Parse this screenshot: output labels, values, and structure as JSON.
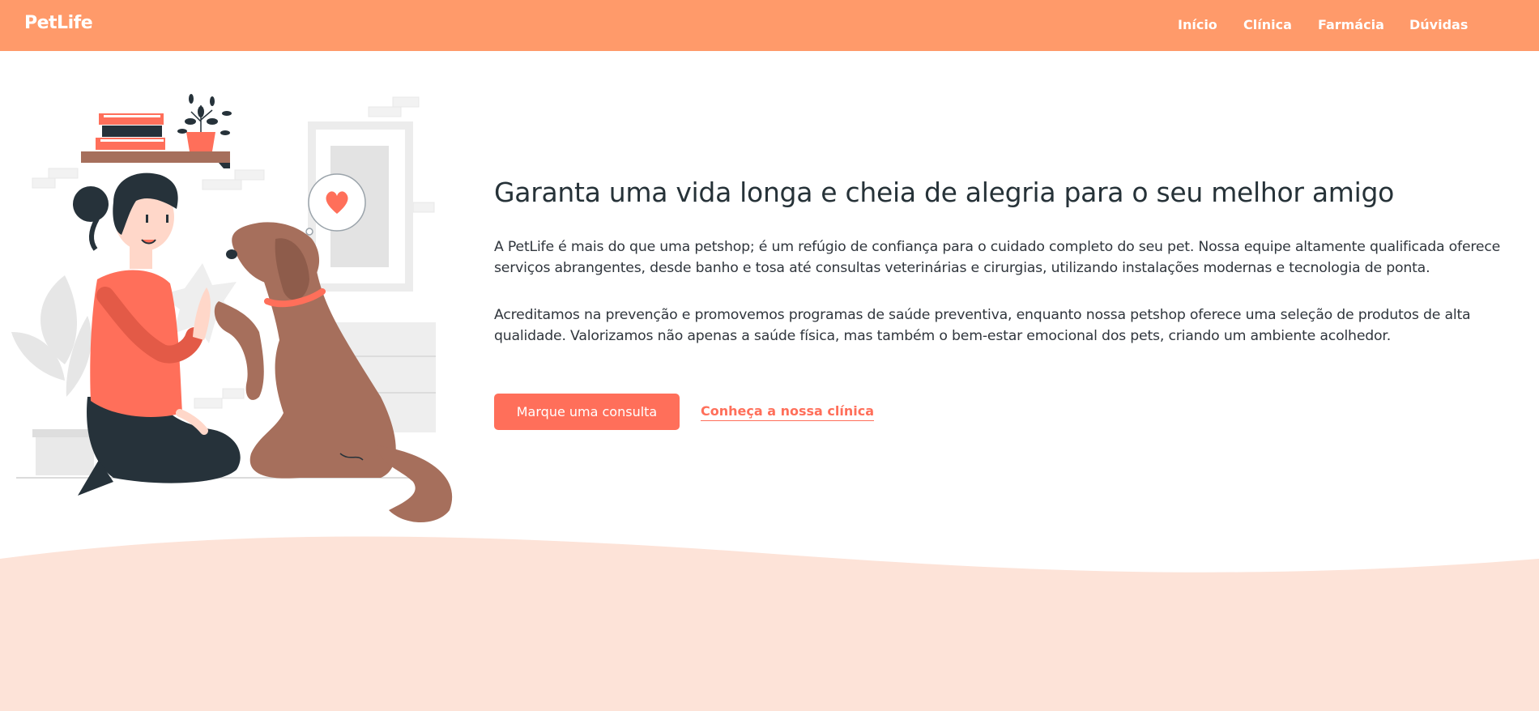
{
  "header": {
    "logo": "PetLife",
    "nav": [
      {
        "label": "Início"
      },
      {
        "label": "Clínica"
      },
      {
        "label": "Farmácia"
      },
      {
        "label": "Dúvidas"
      }
    ]
  },
  "hero": {
    "title": "Garanta uma vida longa e cheia de alegria para o seu melhor amigo",
    "paragraph1": "A PetLife é mais do que uma petshop; é um refúgio de confiança para o cuidado completo do seu pet. Nossa equipe altamente qualificada oferece serviços abrangentes, desde banho e tosa até consultas veterinárias e cirurgias, utilizando instalações modernas e tecnologia de ponta.",
    "paragraph2": "Acreditamos na prevenção e promovemos programas de saúde preventiva, enquanto nossa petshop oferece uma seleção de produtos de alta qualidade. Valorizamos não apenas a saúde física, mas também o bem-estar emocional dos pets, criando um ambiente acolhedor.",
    "cta_primary": "Marque uma consulta",
    "cta_secondary": "Conheça a nossa clínica"
  },
  "colors": {
    "header_bg": "#ff9a6a",
    "accent": "#ff6f5a",
    "wave": "#fde3d8",
    "text_dark": "#263238"
  },
  "icons": {
    "illustration": "woman-high-five-dog-illustration",
    "bubble": "heart-icon"
  }
}
